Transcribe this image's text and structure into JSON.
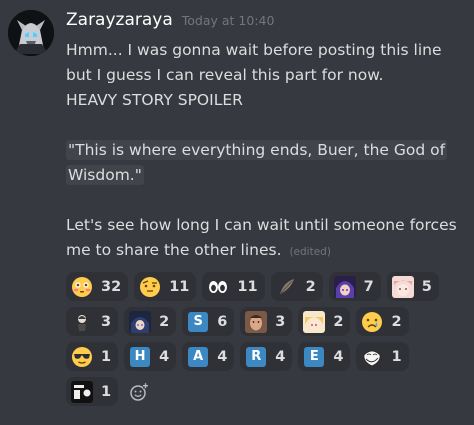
{
  "message": {
    "author": "Zarayzaraya",
    "timestamp": "Today at 10:40",
    "paragraph1": "Hmm... I was gonna wait before posting this line but I guess I can reveal this part for now.",
    "paragraph1_line2": "HEAVY STORY SPOILER",
    "quote": "\"This is where everything ends, Buer, the God of Wisdom.\"",
    "paragraph3": "Let's see how long I can wait until someone forces me to share the other lines.",
    "edited_label": "(edited)"
  },
  "reactions": [
    {
      "emoji": "😳",
      "icon": "flushed-face-icon",
      "count": "32"
    },
    {
      "emoji": "🤨",
      "icon": "raised-eyebrow-face-icon",
      "count": "11"
    },
    {
      "emoji": "👀",
      "icon": "eyes-icon",
      "count": "11"
    },
    {
      "emoji": "image",
      "icon": "custom-emoji-feather-icon",
      "count": "2"
    },
    {
      "emoji": "image",
      "icon": "custom-emoji-purple-character-icon",
      "count": "7"
    },
    {
      "emoji": "image",
      "icon": "custom-emoji-pink-character-icon",
      "count": "5"
    },
    {
      "emoji": "image",
      "icon": "custom-emoji-small-character-icon",
      "count": "3"
    },
    {
      "emoji": "image",
      "icon": "custom-emoji-blue-character-icon",
      "count": "2"
    },
    {
      "emoji": "S",
      "icon": "regional-indicator-s-icon",
      "count": "6"
    },
    {
      "emoji": "image",
      "icon": "custom-emoji-face-photo-icon",
      "count": "3"
    },
    {
      "emoji": "image",
      "icon": "custom-emoji-blonde-character-icon",
      "count": "2"
    },
    {
      "emoji": "😢",
      "icon": "crying-face-icon",
      "count": "2"
    },
    {
      "emoji": "😎",
      "icon": "sunglasses-face-icon",
      "count": "1"
    },
    {
      "emoji": "H",
      "icon": "regional-indicator-h-icon",
      "count": "4"
    },
    {
      "emoji": "A",
      "icon": "regional-indicator-a-icon",
      "count": "4"
    },
    {
      "emoji": "R",
      "icon": "regional-indicator-r-icon",
      "count": "4"
    },
    {
      "emoji": "E",
      "icon": "regional-indicator-e-icon",
      "count": "4"
    },
    {
      "emoji": "image",
      "icon": "custom-emoji-troll-face-icon",
      "count": "1"
    },
    {
      "emoji": "image",
      "icon": "custom-emoji-meme-icon",
      "count": "1"
    }
  ],
  "colors": {
    "background": "#36393f",
    "reaction_bg": "#2f3136",
    "username": "#ffffff",
    "muted": "#72767d",
    "text": "#dcddde",
    "regional_tile": "#3b88c3"
  }
}
